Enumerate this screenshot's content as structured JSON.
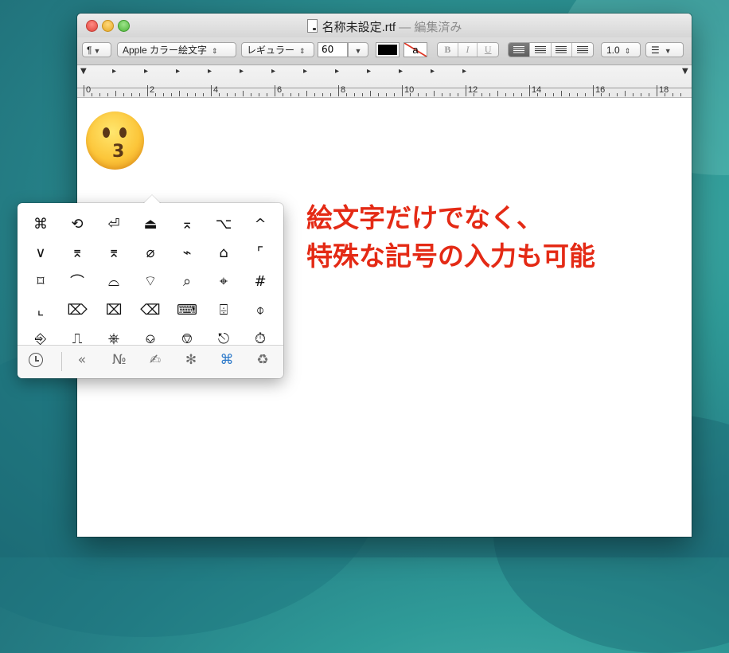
{
  "window": {
    "title": "名称未設定.rtf",
    "title_status": "— 編集済み"
  },
  "toolbar": {
    "paragraph_btn": "¶",
    "font_family": "Apple カラー絵文字",
    "font_style": "レギュラー",
    "font_size": "60",
    "bold": "B",
    "italic": "I",
    "underline": "U",
    "line_spacing": "1.0",
    "text_color": "#000000",
    "highlight_letter": "a"
  },
  "ruler": {
    "labels": [
      "0",
      "2",
      "4",
      "6",
      "8",
      "10",
      "12",
      "14",
      "16",
      "18"
    ]
  },
  "document": {
    "content_emoji": "kissing-face-emoji"
  },
  "symbol_picker": {
    "symbols": [
      "⌘",
      "⟲",
      "⏎",
      "⏏",
      "⌅",
      "⌥",
      "^",
      "∨",
      "⌆",
      "⌆",
      "⌀",
      "⌁",
      "⌂",
      "⌜",
      "⌑",
      "⌒",
      "⌓",
      "⌔",
      "⌕",
      "⌖",
      "#",
      "⌞",
      "⌦",
      "⌧",
      "⌫",
      "⌨",
      "⌹",
      "⌽",
      "⎆",
      "⎍",
      "⎈",
      "⎉",
      "⎊",
      "⎋",
      "⏱"
    ],
    "categories": [
      "recent-clock-icon",
      "«",
      "№",
      "✍",
      "✻",
      "⌘",
      "♻"
    ],
    "active_category": "⌘"
  },
  "caption": {
    "line1": "絵文字だけでなく、",
    "line2": "特殊な記号の入力も可能"
  }
}
